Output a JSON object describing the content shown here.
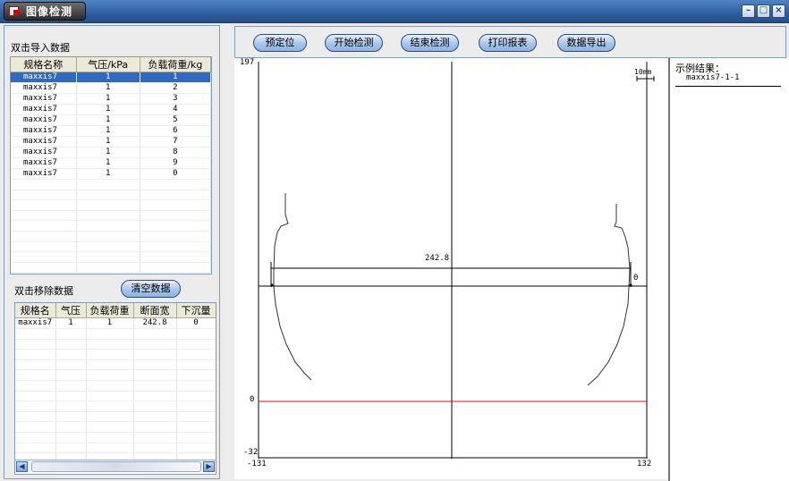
{
  "window": {
    "title": "图像检测"
  },
  "import": {
    "label": "双击导入数据",
    "columns": [
      "规格名称",
      "气压/kPa",
      "负载荷重/kg"
    ],
    "rows": [
      [
        "maxxis7",
        "1",
        "1"
      ],
      [
        "maxxis7",
        "1",
        "2"
      ],
      [
        "maxxis7",
        "1",
        "3"
      ],
      [
        "maxxis7",
        "1",
        "4"
      ],
      [
        "maxxis7",
        "1",
        "5"
      ],
      [
        "maxxis7",
        "1",
        "6"
      ],
      [
        "maxxis7",
        "1",
        "7"
      ],
      [
        "maxxis7",
        "1",
        "8"
      ],
      [
        "maxxis7",
        "1",
        "9"
      ],
      [
        "maxxis7",
        "1",
        "0"
      ]
    ]
  },
  "remove": {
    "label": "双击移除数据",
    "clear_label": "清空数据",
    "columns": [
      "规格名",
      "气压",
      "负载荷重",
      "断面宽",
      "下沉量"
    ],
    "rows": [
      [
        "maxxis7",
        "1",
        "1",
        "242.8",
        "0"
      ]
    ]
  },
  "toolbar": {
    "preset_label": "预定位",
    "start_label": "开始检测",
    "end_label": "结束检测",
    "print_label": "打印报表",
    "export_label": "数据导出"
  },
  "plot": {
    "y_top": "197",
    "y_zero": "0",
    "y_bottom": "-32",
    "x_left": "-131",
    "x_right": "132",
    "scale_label": "10mm",
    "width_label": "242.8",
    "sink_label": "0"
  },
  "results": {
    "title": "示例结果：",
    "items": [
      "maxxis7-1-1"
    ]
  },
  "colors": {
    "accent": "#2e5e9e",
    "selection": "#316ac5",
    "baseline": "#ff0000"
  }
}
